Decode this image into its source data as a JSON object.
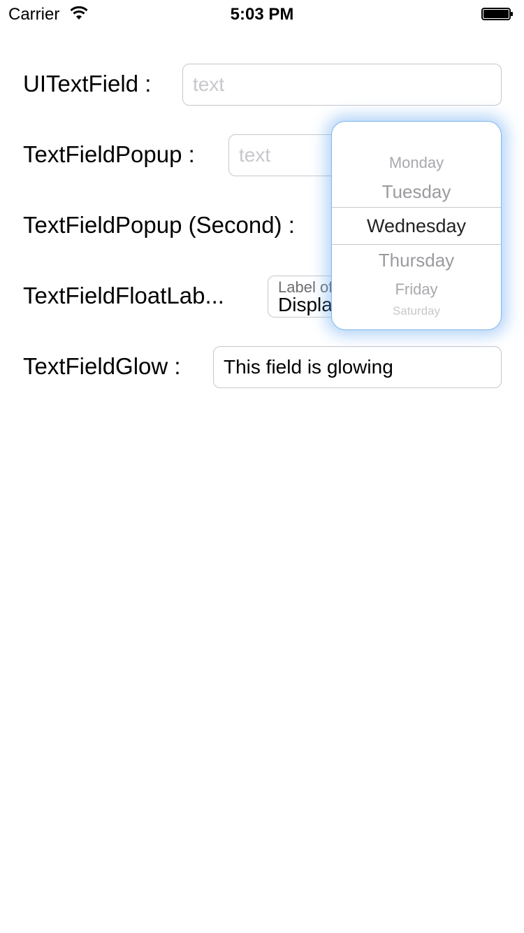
{
  "status_bar": {
    "carrier": "Carrier",
    "time": "5:03 PM",
    "wifi_icon": "wifi-icon",
    "battery_icon": "battery-full-icon"
  },
  "rows": {
    "uitextfield": {
      "label": "UITextField :",
      "placeholder": "text",
      "value": ""
    },
    "popup": {
      "label": "TextFieldPopup :",
      "placeholder": "text",
      "value": ""
    },
    "popup_second": {
      "label": "TextFieldPopup (Second) :"
    },
    "float_label": {
      "label": "TextFieldFloatLab...",
      "floating_label": "Label of",
      "value": "Display"
    },
    "glow": {
      "label": "TextFieldGlow :",
      "value": "This field is glowing"
    }
  },
  "picker": {
    "items": [
      "Monday",
      "Tuesday",
      "Wednesday",
      "Thursday",
      "Friday",
      "Saturday"
    ],
    "selected": "Wednesday",
    "accent_color": "#7fb8ec"
  }
}
